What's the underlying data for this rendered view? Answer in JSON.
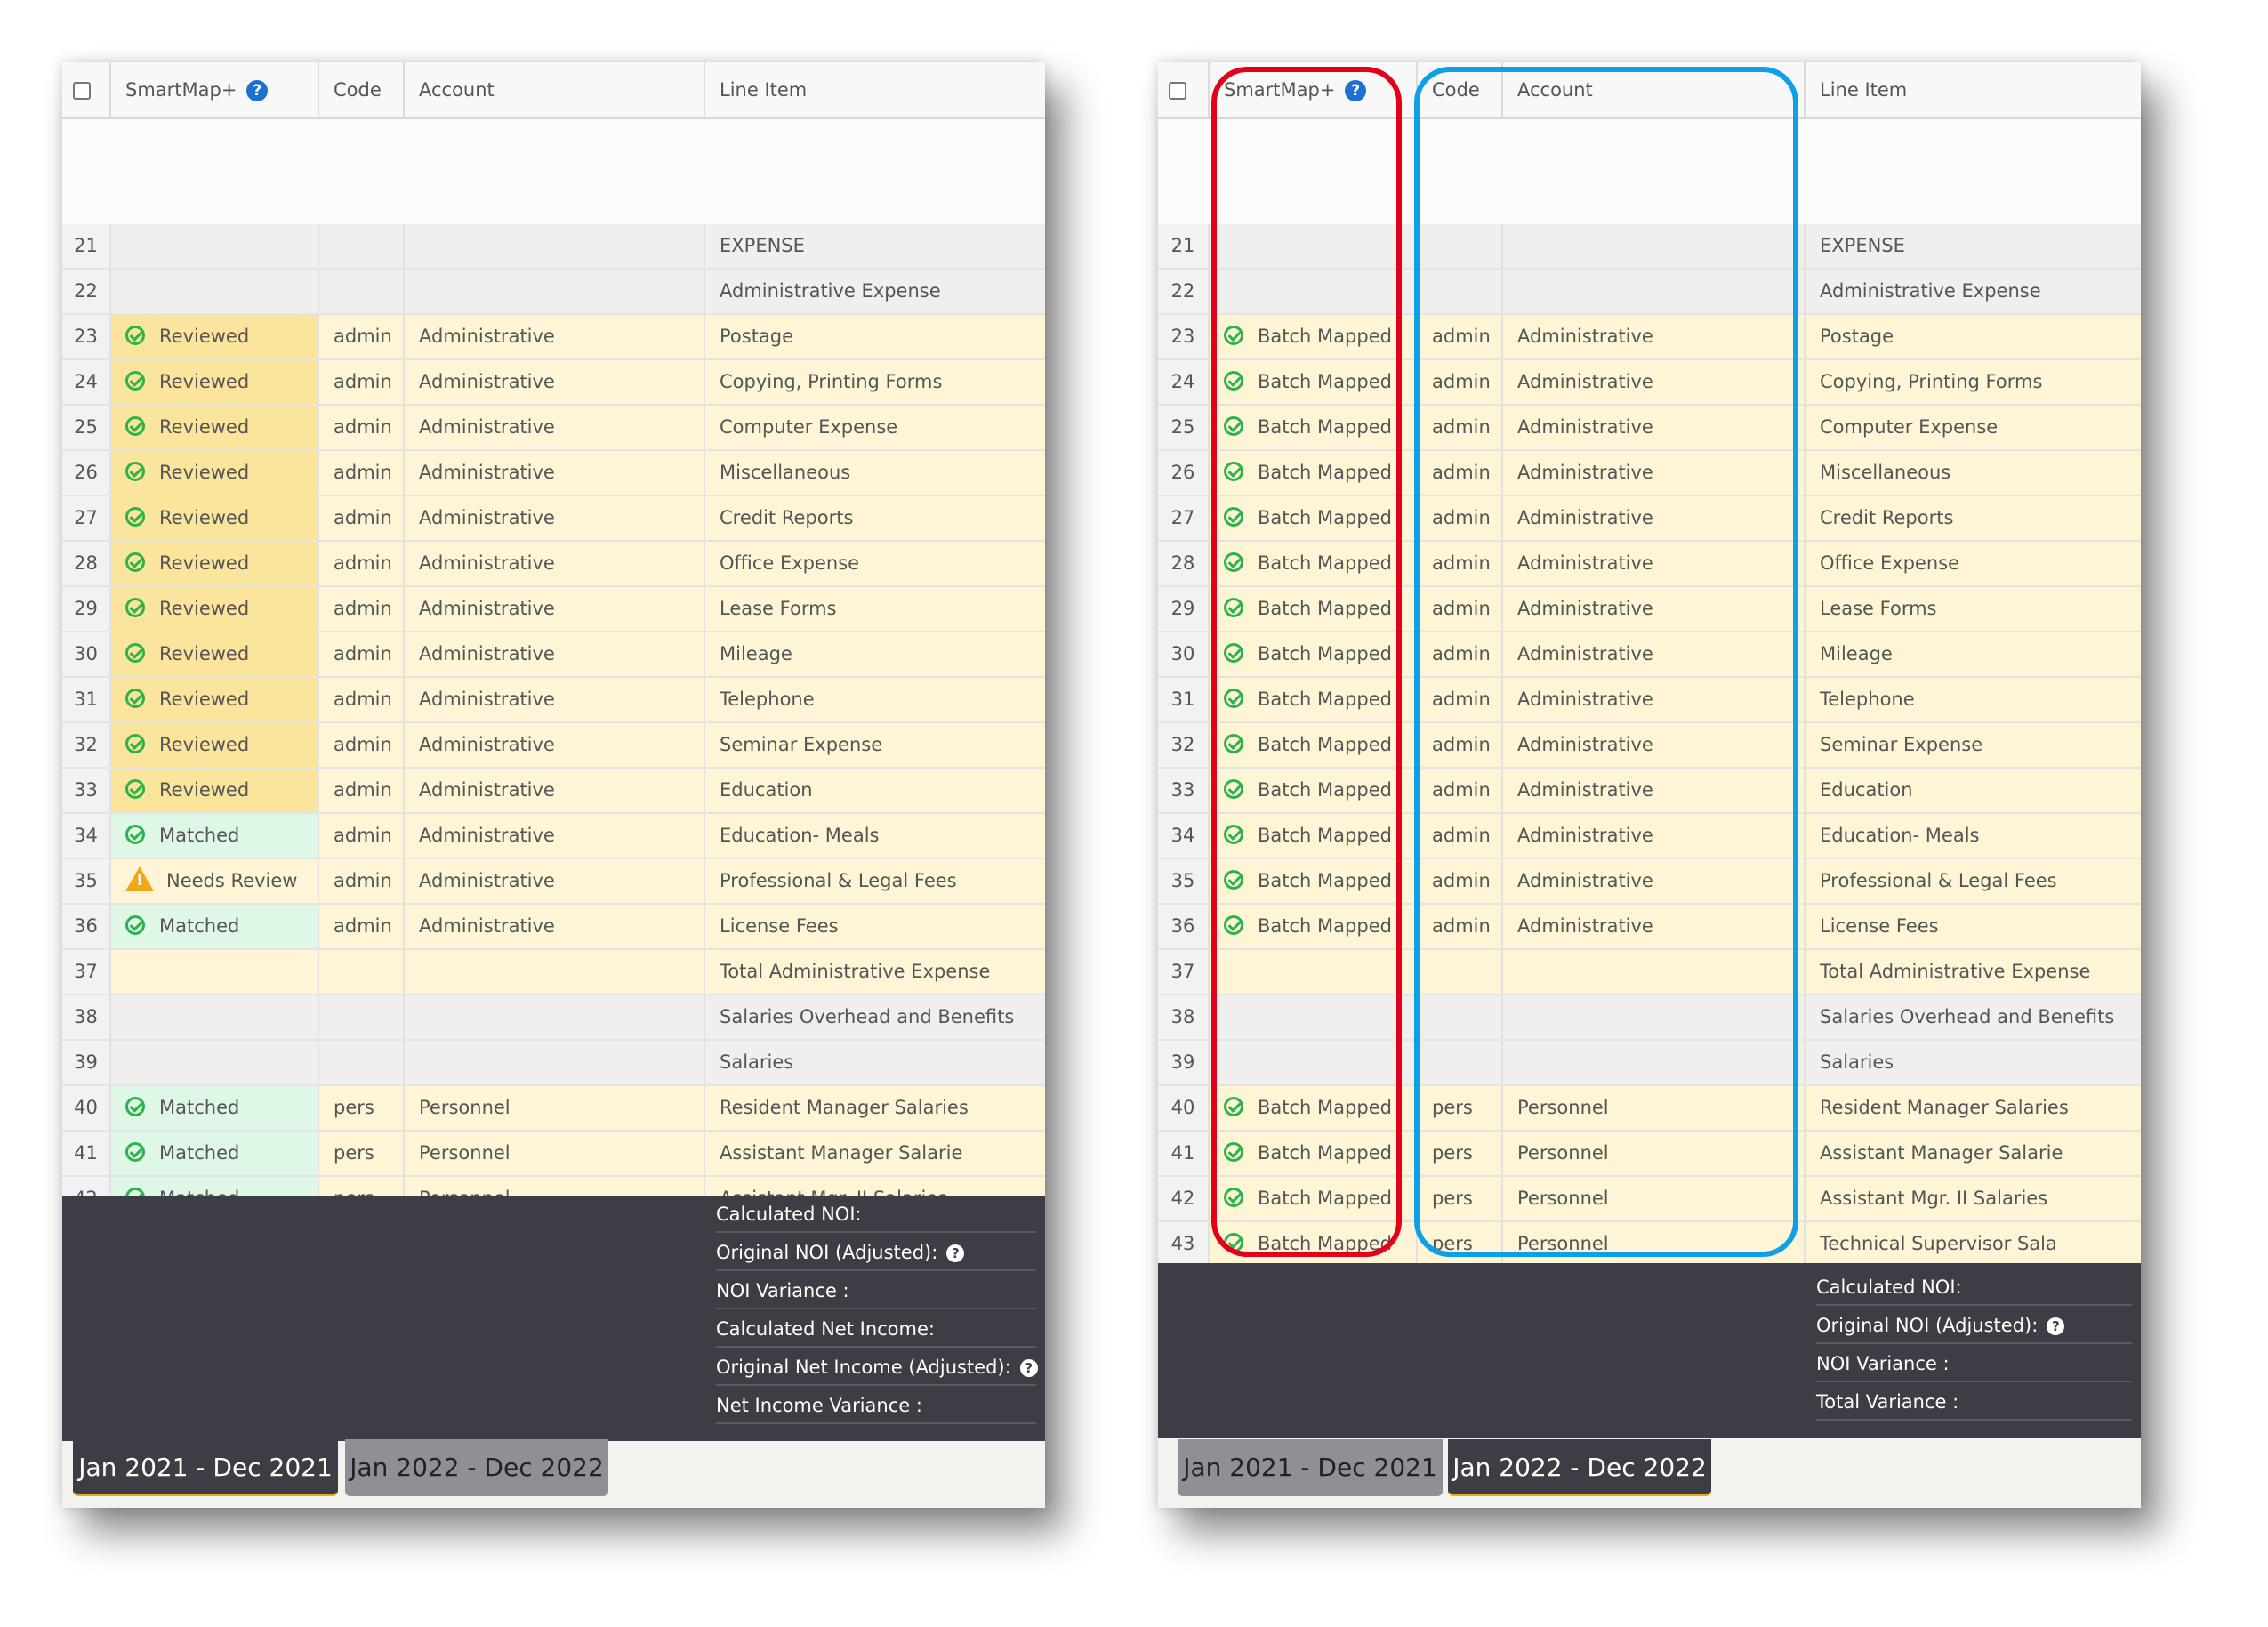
{
  "headers": {
    "smartmap": "SmartMap+",
    "code": "Code",
    "account": "Account",
    "line_item": "Line Item",
    "help": "?"
  },
  "left": {
    "rows": [
      {
        "num": "21",
        "status": "",
        "kind": "",
        "code": "",
        "account": "",
        "line_item": "EXPENSE",
        "bg": "gray"
      },
      {
        "num": "22",
        "status": "",
        "kind": "",
        "code": "",
        "account": "",
        "line_item": "Administrative Expense",
        "bg": "gray"
      },
      {
        "num": "23",
        "status": "Reviewed",
        "kind": "reviewed",
        "code": "admin",
        "account": "Administrative",
        "line_item": "Postage",
        "bg": "yellow"
      },
      {
        "num": "24",
        "status": "Reviewed",
        "kind": "reviewed",
        "code": "admin",
        "account": "Administrative",
        "line_item": "Copying, Printing Forms",
        "bg": "yellow"
      },
      {
        "num": "25",
        "status": "Reviewed",
        "kind": "reviewed",
        "code": "admin",
        "account": "Administrative",
        "line_item": "Computer Expense",
        "bg": "yellow"
      },
      {
        "num": "26",
        "status": "Reviewed",
        "kind": "reviewed",
        "code": "admin",
        "account": "Administrative",
        "line_item": "Miscellaneous",
        "bg": "yellow"
      },
      {
        "num": "27",
        "status": "Reviewed",
        "kind": "reviewed",
        "code": "admin",
        "account": "Administrative",
        "line_item": "Credit Reports",
        "bg": "yellow"
      },
      {
        "num": "28",
        "status": "Reviewed",
        "kind": "reviewed",
        "code": "admin",
        "account": "Administrative",
        "line_item": "Office Expense",
        "bg": "yellow"
      },
      {
        "num": "29",
        "status": "Reviewed",
        "kind": "reviewed",
        "code": "admin",
        "account": "Administrative",
        "line_item": "Lease Forms",
        "bg": "yellow"
      },
      {
        "num": "30",
        "status": "Reviewed",
        "kind": "reviewed",
        "code": "admin",
        "account": "Administrative",
        "line_item": "Mileage",
        "bg": "yellow"
      },
      {
        "num": "31",
        "status": "Reviewed",
        "kind": "reviewed",
        "code": "admin",
        "account": "Administrative",
        "line_item": "Telephone",
        "bg": "yellow"
      },
      {
        "num": "32",
        "status": "Reviewed",
        "kind": "reviewed",
        "code": "admin",
        "account": "Administrative",
        "line_item": "Seminar Expense",
        "bg": "yellow"
      },
      {
        "num": "33",
        "status": "Reviewed",
        "kind": "reviewed",
        "code": "admin",
        "account": "Administrative",
        "line_item": "Education",
        "bg": "yellow"
      },
      {
        "num": "34",
        "status": "Matched",
        "kind": "matched",
        "code": "admin",
        "account": "Administrative",
        "line_item": "Education- Meals",
        "bg": "yellow"
      },
      {
        "num": "35",
        "status": "Needs Review",
        "kind": "needs",
        "code": "admin",
        "account": "Administrative",
        "line_item": "Professional & Legal Fees",
        "bg": "yellow"
      },
      {
        "num": "36",
        "status": "Matched",
        "kind": "matched",
        "code": "admin",
        "account": "Administrative",
        "line_item": "License Fees",
        "bg": "yellow"
      },
      {
        "num": "37",
        "status": "",
        "kind": "",
        "code": "",
        "account": "",
        "line_item": "Total Administrative Expense",
        "bg": "yellow"
      },
      {
        "num": "38",
        "status": "",
        "kind": "",
        "code": "",
        "account": "",
        "line_item": "Salaries Overhead and Benefits",
        "bg": "gray"
      },
      {
        "num": "39",
        "status": "",
        "kind": "",
        "code": "",
        "account": "",
        "line_item": "Salaries",
        "bg": "gray"
      },
      {
        "num": "40",
        "status": "Matched",
        "kind": "matched",
        "code": "pers",
        "account": "Personnel",
        "line_item": "Resident Manager Salaries",
        "bg": "yellow"
      },
      {
        "num": "41",
        "status": "Matched",
        "kind": "matched",
        "code": "pers",
        "account": "Personnel",
        "line_item": "Assistant Manager Salarie",
        "bg": "yellow"
      },
      {
        "num": "42",
        "status": "Matched",
        "kind": "matched",
        "code": "pers",
        "account": "Personnel",
        "line_item": "Assistant Mgr. II Salaries",
        "bg": "yellow"
      }
    ],
    "metrics": [
      "Calculated NOI:",
      "Original NOI (Adjusted):",
      "NOI Variance :",
      "Calculated Net Income:",
      "Original Net Income (Adjusted):",
      "Net Income Variance :"
    ],
    "tabs": [
      "Jan 2021 - Dec 2021",
      "Jan 2022 - Dec 2022"
    ]
  },
  "right": {
    "rows": [
      {
        "num": "21",
        "status": "",
        "kind": "",
        "code": "",
        "account": "",
        "line_item": "EXPENSE",
        "bg": "gray"
      },
      {
        "num": "22",
        "status": "",
        "kind": "",
        "code": "",
        "account": "",
        "line_item": "Administrative Expense",
        "bg": "gray"
      },
      {
        "num": "23",
        "status": "Batch Mapped",
        "kind": "batch",
        "code": "admin",
        "account": "Administrative",
        "line_item": "Postage",
        "bg": "yellow"
      },
      {
        "num": "24",
        "status": "Batch Mapped",
        "kind": "batch",
        "code": "admin",
        "account": "Administrative",
        "line_item": "Copying, Printing Forms",
        "bg": "yellow"
      },
      {
        "num": "25",
        "status": "Batch Mapped",
        "kind": "batch",
        "code": "admin",
        "account": "Administrative",
        "line_item": "Computer Expense",
        "bg": "yellow"
      },
      {
        "num": "26",
        "status": "Batch Mapped",
        "kind": "batch",
        "code": "admin",
        "account": "Administrative",
        "line_item": "Miscellaneous",
        "bg": "yellow"
      },
      {
        "num": "27",
        "status": "Batch Mapped",
        "kind": "batch",
        "code": "admin",
        "account": "Administrative",
        "line_item": "Credit Reports",
        "bg": "yellow"
      },
      {
        "num": "28",
        "status": "Batch Mapped",
        "kind": "batch",
        "code": "admin",
        "account": "Administrative",
        "line_item": "Office Expense",
        "bg": "yellow"
      },
      {
        "num": "29",
        "status": "Batch Mapped",
        "kind": "batch",
        "code": "admin",
        "account": "Administrative",
        "line_item": "Lease Forms",
        "bg": "yellow"
      },
      {
        "num": "30",
        "status": "Batch Mapped",
        "kind": "batch",
        "code": "admin",
        "account": "Administrative",
        "line_item": "Mileage",
        "bg": "yellow"
      },
      {
        "num": "31",
        "status": "Batch Mapped",
        "kind": "batch",
        "code": "admin",
        "account": "Administrative",
        "line_item": "Telephone",
        "bg": "yellow"
      },
      {
        "num": "32",
        "status": "Batch Mapped",
        "kind": "batch",
        "code": "admin",
        "account": "Administrative",
        "line_item": "Seminar Expense",
        "bg": "yellow"
      },
      {
        "num": "33",
        "status": "Batch Mapped",
        "kind": "batch",
        "code": "admin",
        "account": "Administrative",
        "line_item": "Education",
        "bg": "yellow"
      },
      {
        "num": "34",
        "status": "Batch Mapped",
        "kind": "batch",
        "code": "admin",
        "account": "Administrative",
        "line_item": "Education- Meals",
        "bg": "yellow"
      },
      {
        "num": "35",
        "status": "Batch Mapped",
        "kind": "batch",
        "code": "admin",
        "account": "Administrative",
        "line_item": "Professional & Legal Fees",
        "bg": "yellow"
      },
      {
        "num": "36",
        "status": "Batch Mapped",
        "kind": "batch",
        "code": "admin",
        "account": "Administrative",
        "line_item": "License Fees",
        "bg": "yellow"
      },
      {
        "num": "37",
        "status": "",
        "kind": "",
        "code": "",
        "account": "",
        "line_item": "Total Administrative Expense",
        "bg": "yellow"
      },
      {
        "num": "38",
        "status": "",
        "kind": "",
        "code": "",
        "account": "",
        "line_item": "Salaries Overhead and Benefits",
        "bg": "gray"
      },
      {
        "num": "39",
        "status": "",
        "kind": "",
        "code": "",
        "account": "",
        "line_item": "Salaries",
        "bg": "gray"
      },
      {
        "num": "40",
        "status": "Batch Mapped",
        "kind": "batch",
        "code": "pers",
        "account": "Personnel",
        "line_item": "Resident Manager Salaries",
        "bg": "yellow"
      },
      {
        "num": "41",
        "status": "Batch Mapped",
        "kind": "batch",
        "code": "pers",
        "account": "Personnel",
        "line_item": "Assistant Manager Salarie",
        "bg": "yellow"
      },
      {
        "num": "42",
        "status": "Batch Mapped",
        "kind": "batch",
        "code": "pers",
        "account": "Personnel",
        "line_item": "Assistant Mgr. II Salaries",
        "bg": "yellow"
      },
      {
        "num": "43",
        "status": "Batch Mapped",
        "kind": "batch",
        "code": "pers",
        "account": "Personnel",
        "line_item": "Technical Supervisor Sala",
        "bg": "yellow"
      }
    ],
    "metrics": [
      "Calculated NOI:",
      "Original NOI (Adjusted):",
      "NOI Variance :",
      "Total Variance :"
    ],
    "tabs": [
      "Jan 2021 - Dec 2021",
      "Jan 2022 - Dec 2022"
    ]
  },
  "colors": {
    "highlight_red": "#e3001b",
    "highlight_blue": "#0ea0e6",
    "status_check": "#2db34a",
    "warning": "#f0a818"
  }
}
